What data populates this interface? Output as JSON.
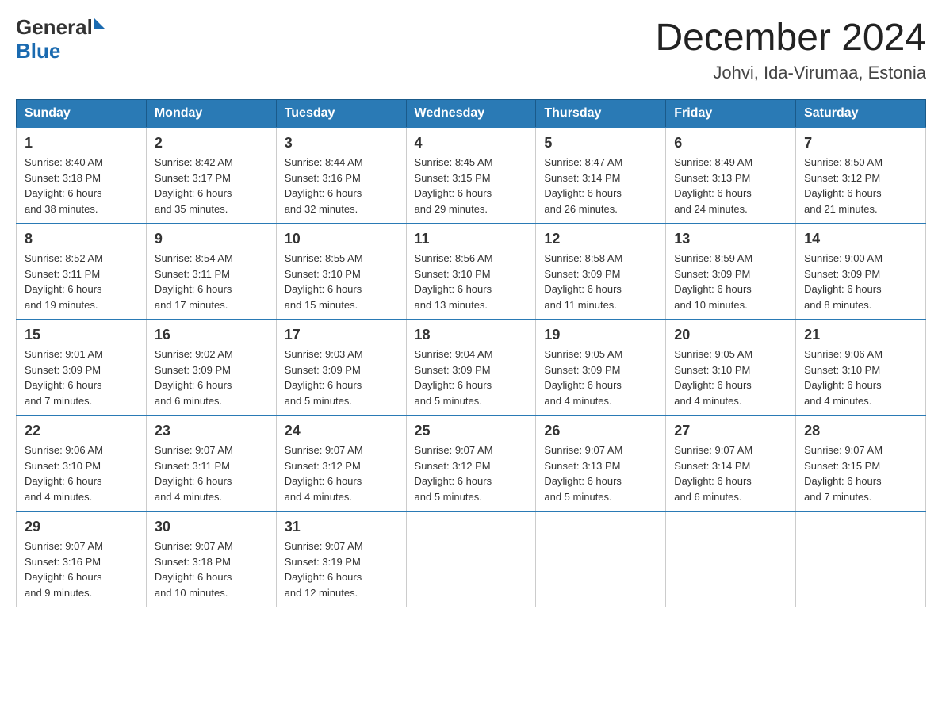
{
  "header": {
    "logo_general": "General",
    "logo_blue": "Blue",
    "title": "December 2024",
    "subtitle": "Johvi, Ida-Virumaa, Estonia"
  },
  "columns": [
    "Sunday",
    "Monday",
    "Tuesday",
    "Wednesday",
    "Thursday",
    "Friday",
    "Saturday"
  ],
  "weeks": [
    [
      {
        "day": "1",
        "info": "Sunrise: 8:40 AM\nSunset: 3:18 PM\nDaylight: 6 hours\nand 38 minutes."
      },
      {
        "day": "2",
        "info": "Sunrise: 8:42 AM\nSunset: 3:17 PM\nDaylight: 6 hours\nand 35 minutes."
      },
      {
        "day": "3",
        "info": "Sunrise: 8:44 AM\nSunset: 3:16 PM\nDaylight: 6 hours\nand 32 minutes."
      },
      {
        "day": "4",
        "info": "Sunrise: 8:45 AM\nSunset: 3:15 PM\nDaylight: 6 hours\nand 29 minutes."
      },
      {
        "day": "5",
        "info": "Sunrise: 8:47 AM\nSunset: 3:14 PM\nDaylight: 6 hours\nand 26 minutes."
      },
      {
        "day": "6",
        "info": "Sunrise: 8:49 AM\nSunset: 3:13 PM\nDaylight: 6 hours\nand 24 minutes."
      },
      {
        "day": "7",
        "info": "Sunrise: 8:50 AM\nSunset: 3:12 PM\nDaylight: 6 hours\nand 21 minutes."
      }
    ],
    [
      {
        "day": "8",
        "info": "Sunrise: 8:52 AM\nSunset: 3:11 PM\nDaylight: 6 hours\nand 19 minutes."
      },
      {
        "day": "9",
        "info": "Sunrise: 8:54 AM\nSunset: 3:11 PM\nDaylight: 6 hours\nand 17 minutes."
      },
      {
        "day": "10",
        "info": "Sunrise: 8:55 AM\nSunset: 3:10 PM\nDaylight: 6 hours\nand 15 minutes."
      },
      {
        "day": "11",
        "info": "Sunrise: 8:56 AM\nSunset: 3:10 PM\nDaylight: 6 hours\nand 13 minutes."
      },
      {
        "day": "12",
        "info": "Sunrise: 8:58 AM\nSunset: 3:09 PM\nDaylight: 6 hours\nand 11 minutes."
      },
      {
        "day": "13",
        "info": "Sunrise: 8:59 AM\nSunset: 3:09 PM\nDaylight: 6 hours\nand 10 minutes."
      },
      {
        "day": "14",
        "info": "Sunrise: 9:00 AM\nSunset: 3:09 PM\nDaylight: 6 hours\nand 8 minutes."
      }
    ],
    [
      {
        "day": "15",
        "info": "Sunrise: 9:01 AM\nSunset: 3:09 PM\nDaylight: 6 hours\nand 7 minutes."
      },
      {
        "day": "16",
        "info": "Sunrise: 9:02 AM\nSunset: 3:09 PM\nDaylight: 6 hours\nand 6 minutes."
      },
      {
        "day": "17",
        "info": "Sunrise: 9:03 AM\nSunset: 3:09 PM\nDaylight: 6 hours\nand 5 minutes."
      },
      {
        "day": "18",
        "info": "Sunrise: 9:04 AM\nSunset: 3:09 PM\nDaylight: 6 hours\nand 5 minutes."
      },
      {
        "day": "19",
        "info": "Sunrise: 9:05 AM\nSunset: 3:09 PM\nDaylight: 6 hours\nand 4 minutes."
      },
      {
        "day": "20",
        "info": "Sunrise: 9:05 AM\nSunset: 3:10 PM\nDaylight: 6 hours\nand 4 minutes."
      },
      {
        "day": "21",
        "info": "Sunrise: 9:06 AM\nSunset: 3:10 PM\nDaylight: 6 hours\nand 4 minutes."
      }
    ],
    [
      {
        "day": "22",
        "info": "Sunrise: 9:06 AM\nSunset: 3:10 PM\nDaylight: 6 hours\nand 4 minutes."
      },
      {
        "day": "23",
        "info": "Sunrise: 9:07 AM\nSunset: 3:11 PM\nDaylight: 6 hours\nand 4 minutes."
      },
      {
        "day": "24",
        "info": "Sunrise: 9:07 AM\nSunset: 3:12 PM\nDaylight: 6 hours\nand 4 minutes."
      },
      {
        "day": "25",
        "info": "Sunrise: 9:07 AM\nSunset: 3:12 PM\nDaylight: 6 hours\nand 5 minutes."
      },
      {
        "day": "26",
        "info": "Sunrise: 9:07 AM\nSunset: 3:13 PM\nDaylight: 6 hours\nand 5 minutes."
      },
      {
        "day": "27",
        "info": "Sunrise: 9:07 AM\nSunset: 3:14 PM\nDaylight: 6 hours\nand 6 minutes."
      },
      {
        "day": "28",
        "info": "Sunrise: 9:07 AM\nSunset: 3:15 PM\nDaylight: 6 hours\nand 7 minutes."
      }
    ],
    [
      {
        "day": "29",
        "info": "Sunrise: 9:07 AM\nSunset: 3:16 PM\nDaylight: 6 hours\nand 9 minutes."
      },
      {
        "day": "30",
        "info": "Sunrise: 9:07 AM\nSunset: 3:18 PM\nDaylight: 6 hours\nand 10 minutes."
      },
      {
        "day": "31",
        "info": "Sunrise: 9:07 AM\nSunset: 3:19 PM\nDaylight: 6 hours\nand 12 minutes."
      },
      null,
      null,
      null,
      null
    ]
  ]
}
